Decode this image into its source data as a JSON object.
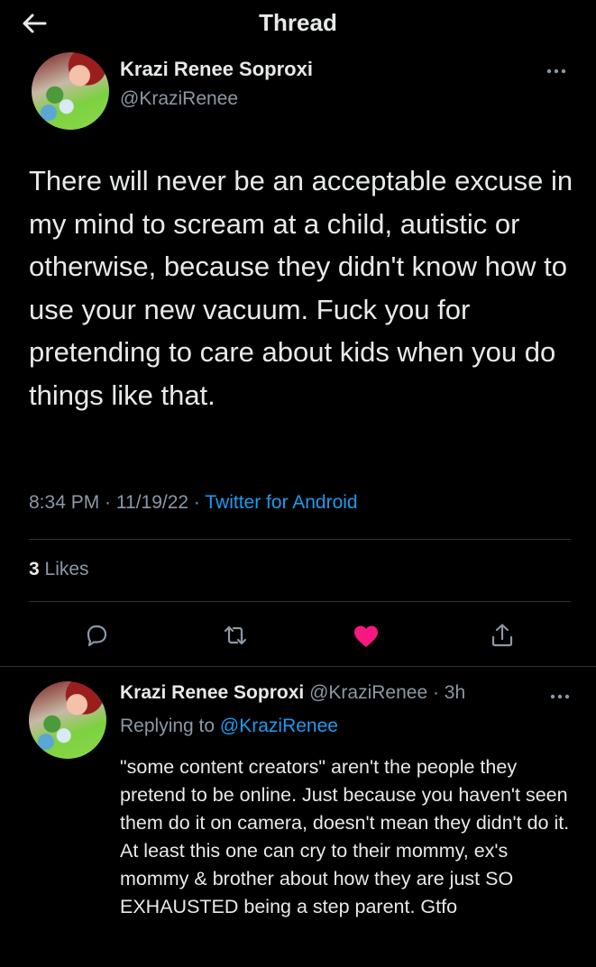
{
  "header": {
    "title": "Thread"
  },
  "main_tweet": {
    "display_name": "Krazi Renee Soproxi",
    "handle": "@KraziRenee",
    "text": "There will never be an acceptable excuse in my mind to scream at a child, autistic or otherwise, because they didn't know how to use your new vacuum. Fuck you for pretending to care about kids when you do things like that.",
    "time": "8:34 PM",
    "separator": " · ",
    "date": "11/19/22",
    "source": "Twitter for Android",
    "likes_count": "3",
    "likes_label": " Likes"
  },
  "actions": {
    "reply_icon": "reply-icon",
    "retweet_icon": "retweet-icon",
    "like_icon": "heart-icon",
    "share_icon": "share-icon",
    "liked": true,
    "like_color": "#f91880"
  },
  "reply": {
    "display_name": "Krazi Renee Soproxi",
    "handle": "@KraziRenee",
    "separator": " · ",
    "age": "3h",
    "replying_prefix": "Replying to ",
    "replying_to": "@KraziRenee",
    "text": "\"some content creators\" aren't the people they pretend to be online. Just because you haven't seen them do it on camera, doesn't mean they didn't do it. At least this one can cry to their mommy, ex's mommy & brother about how they are just SO EXHAUSTED being a step parent. Gtfo"
  },
  "colors": {
    "accent": "#1d9bf0",
    "secondary_text": "#8b98a5",
    "background": "#000000"
  }
}
